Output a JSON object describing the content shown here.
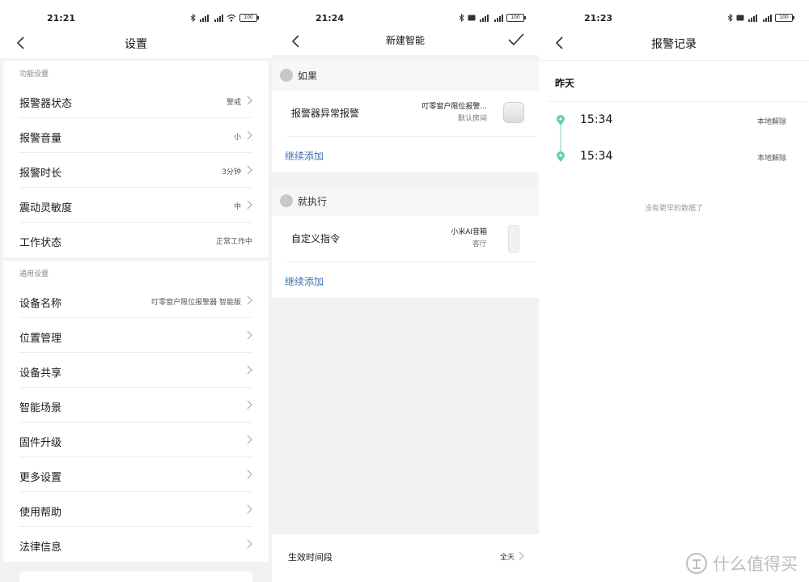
{
  "screen1": {
    "time": "21:21",
    "battery": "100",
    "title": "设置",
    "sections": [
      {
        "header": "功能设置",
        "rows": [
          {
            "label": "报警器状态",
            "value": "警戒",
            "chevron": true
          },
          {
            "label": "报警音量",
            "value": "小",
            "chevron": true
          },
          {
            "label": "报警时长",
            "value": "3分钟",
            "chevron": true
          },
          {
            "label": "震动灵敏度",
            "value": "中",
            "chevron": true
          },
          {
            "label": "工作状态",
            "value": "正常工作中",
            "chevron": false
          }
        ]
      },
      {
        "header": "通用设置",
        "rows": [
          {
            "label": "设备名称",
            "value": "叮零窗户限位报警器 智能版",
            "chevron": true
          },
          {
            "label": "位置管理",
            "value": "",
            "chevron": true
          },
          {
            "label": "设备共享",
            "value": "",
            "chevron": true
          },
          {
            "label": "智能场景",
            "value": "",
            "chevron": true
          },
          {
            "label": "固件升级",
            "value": "",
            "chevron": true
          },
          {
            "label": "更多设置",
            "value": "",
            "chevron": true
          },
          {
            "label": "使用帮助",
            "value": "",
            "chevron": true
          },
          {
            "label": "法律信息",
            "value": "",
            "chevron": true
          }
        ]
      }
    ]
  },
  "screen2": {
    "time": "21:24",
    "battery": "100",
    "title": "新建智能",
    "if_header": "如果",
    "condition": {
      "label": "报警器异常报警",
      "device": "叮零窗户限位报警...",
      "room": "默认房间"
    },
    "add_condition": "继续添加",
    "then_header": "就执行",
    "action": {
      "label": "自定义指令",
      "device": "小米AI音箱",
      "room": "客厅"
    },
    "add_action": "继续添加",
    "period_label": "生效时间段",
    "period_value": "全天"
  },
  "screen3": {
    "time": "21:23",
    "battery": "100",
    "title": "报警记录",
    "date": "昨天",
    "logs": [
      {
        "time": "15:34",
        "status": "本地解除"
      },
      {
        "time": "15:34",
        "status": "本地解除"
      }
    ],
    "no_more": "没有更早的数据了"
  },
  "watermark": {
    "text": "什么值得买"
  },
  "colors": {
    "link": "#3d6fb5",
    "timeline": "#5fcfb0",
    "background": "#f2f2f2"
  }
}
